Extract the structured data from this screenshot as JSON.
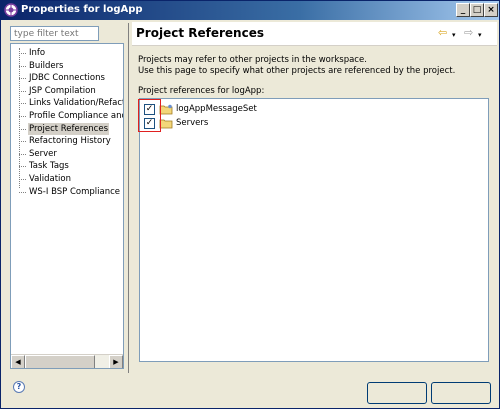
{
  "window": {
    "title": "Properties for logApp"
  },
  "filter": {
    "placeholder": "type filter text"
  },
  "tree": {
    "items": [
      "Info",
      "Builders",
      "JDBC Connections",
      "JSP Compilation",
      "Links Validation/Refactori",
      "Profile Compliance and Va",
      "Project References",
      "Refactoring History",
      "Server",
      "Task Tags",
      "Validation",
      "WS-I BSP Compliance"
    ],
    "selected": "Project References"
  },
  "page": {
    "title": "Project References",
    "desc1": "Projects may refer to other projects in the workspace.",
    "desc2": "Use this page to specify what other projects are referenced by the project.",
    "list_label": "Project references for logApp:",
    "projects": [
      {
        "name": "logAppMessageSet",
        "checked": true
      },
      {
        "name": "Servers",
        "checked": true
      }
    ]
  },
  "icons": {
    "back": "back-arrow-icon",
    "forward": "forward-arrow-icon",
    "help": "help-icon"
  },
  "colors": {
    "title_start": "#0a246a",
    "title_end": "#a6caf0",
    "highlight": "#e02020"
  }
}
